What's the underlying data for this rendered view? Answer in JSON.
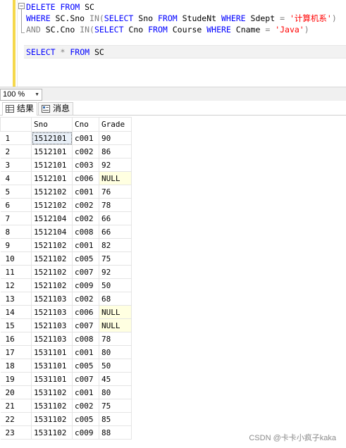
{
  "editor": {
    "fold_symbol": "−",
    "lines": [
      [
        {
          "t": "DELETE",
          "c": "kw"
        },
        {
          "t": " "
        },
        {
          "t": "FROM",
          "c": "kw"
        },
        {
          "t": " SC"
        }
      ],
      [
        {
          "t": "WHERE",
          "c": "kw"
        },
        {
          "t": " SC.Sno "
        },
        {
          "t": "IN(",
          "c": "op"
        },
        {
          "t": "SELECT",
          "c": "kw"
        },
        {
          "t": " Sno "
        },
        {
          "t": "FROM",
          "c": "kw"
        },
        {
          "t": " StudeNt "
        },
        {
          "t": "WHERE",
          "c": "kw"
        },
        {
          "t": " Sdept "
        },
        {
          "t": "=",
          "c": "op"
        },
        {
          "t": " "
        },
        {
          "t": "'计算机系'",
          "c": "str"
        },
        {
          "t": ")",
          "c": "op"
        }
      ],
      [
        {
          "t": "AND",
          "c": "op"
        },
        {
          "t": " SC.Cno "
        },
        {
          "t": "IN(",
          "c": "op"
        },
        {
          "t": "SELECT",
          "c": "kw"
        },
        {
          "t": " Cno "
        },
        {
          "t": "FROM",
          "c": "kw"
        },
        {
          "t": " Course "
        },
        {
          "t": "WHERE",
          "c": "kw"
        },
        {
          "t": " Cname "
        },
        {
          "t": "=",
          "c": "op"
        },
        {
          "t": " "
        },
        {
          "t": "'Java'",
          "c": "str"
        },
        {
          "t": ")",
          "c": "op"
        }
      ],
      [],
      [
        {
          "t": "SELECT",
          "c": "kw"
        },
        {
          "t": " "
        },
        {
          "t": "*",
          "c": "op"
        },
        {
          "t": " "
        },
        {
          "t": "FROM",
          "c": "kw"
        },
        {
          "t": " SC"
        }
      ]
    ]
  },
  "zoom": {
    "value": "100 %",
    "dropdown_glyph": "▼"
  },
  "tabs": {
    "results": "结果",
    "messages": "消息"
  },
  "grid": {
    "columns": [
      "Sno",
      "Cno",
      "Grade"
    ],
    "rows": [
      [
        "1",
        "1512101",
        "c001",
        "90"
      ],
      [
        "2",
        "1512101",
        "c002",
        "86"
      ],
      [
        "3",
        "1512101",
        "c003",
        "92"
      ],
      [
        "4",
        "1512101",
        "c006",
        "NULL"
      ],
      [
        "5",
        "1512102",
        "c001",
        "76"
      ],
      [
        "6",
        "1512102",
        "c002",
        "78"
      ],
      [
        "7",
        "1512104",
        "c002",
        "66"
      ],
      [
        "8",
        "1512104",
        "c008",
        "66"
      ],
      [
        "9",
        "1521102",
        "c001",
        "82"
      ],
      [
        "10",
        "1521102",
        "c005",
        "75"
      ],
      [
        "11",
        "1521102",
        "c007",
        "92"
      ],
      [
        "12",
        "1521102",
        "c009",
        "50"
      ],
      [
        "13",
        "1521103",
        "c002",
        "68"
      ],
      [
        "14",
        "1521103",
        "c006",
        "NULL"
      ],
      [
        "15",
        "1521103",
        "c007",
        "NULL"
      ],
      [
        "16",
        "1521103",
        "c008",
        "78"
      ],
      [
        "17",
        "1531101",
        "c001",
        "80"
      ],
      [
        "18",
        "1531101",
        "c005",
        "50"
      ],
      [
        "19",
        "1531101",
        "c007",
        "45"
      ],
      [
        "20",
        "1531102",
        "c001",
        "80"
      ],
      [
        "21",
        "1531102",
        "c002",
        "75"
      ],
      [
        "22",
        "1531102",
        "c005",
        "85"
      ],
      [
        "23",
        "1531102",
        "c009",
        "88"
      ]
    ]
  },
  "watermark": "CSDN @卡卡小疯子kaka"
}
